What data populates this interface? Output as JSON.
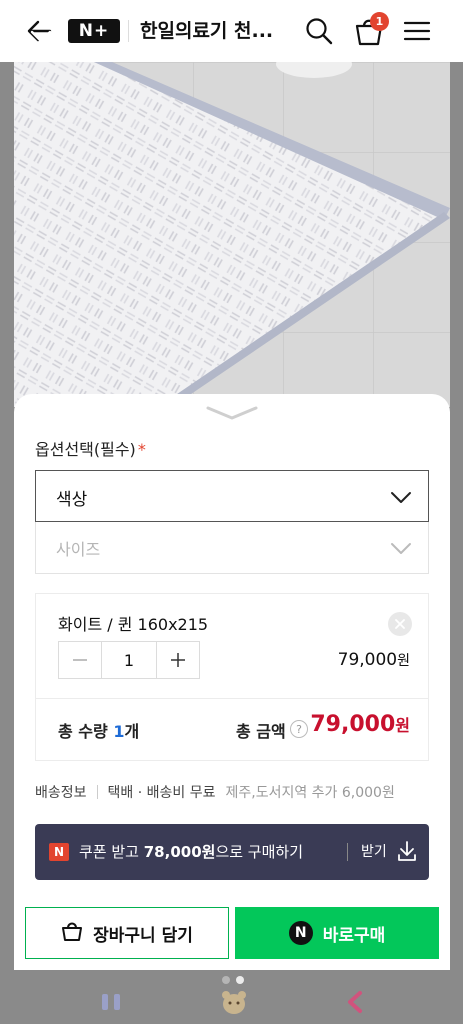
{
  "header": {
    "badge": "N+",
    "title": "한일의료기 천...",
    "cart_count": "1"
  },
  "options": {
    "title": "옵션선택(필수)",
    "required_mark": "*",
    "color_select": "색상",
    "size_select": "사이즈"
  },
  "selected_item": {
    "name": "화이트 / 퀸 160x215",
    "quantity": "1",
    "price": "79,000",
    "price_unit": "원"
  },
  "totals": {
    "qty_prefix": "총 수량",
    "qty_value": "1",
    "qty_unit": "개",
    "amount_label": "총 금액",
    "help": "?",
    "amount": "79,000",
    "amount_unit": "원"
  },
  "shipping": {
    "label": "배송정보",
    "method": "택배 · 배송비 무료",
    "extra": "제주,도서지역 추가 6,000원"
  },
  "coupon": {
    "icon": "N",
    "text_pre": "쿠폰 받고",
    "text_amount": "78,000원",
    "text_post": "으로 구매하기",
    "receive": "받기"
  },
  "actions": {
    "cart_label": "장바구니 담기",
    "buy_icon": "N",
    "buy_label": "바로구매"
  },
  "colors": {
    "accent_green": "#03c75a",
    "price_red": "#c8102e",
    "coupon_bg": "#3a3b55",
    "badge_red": "#e2442f"
  }
}
